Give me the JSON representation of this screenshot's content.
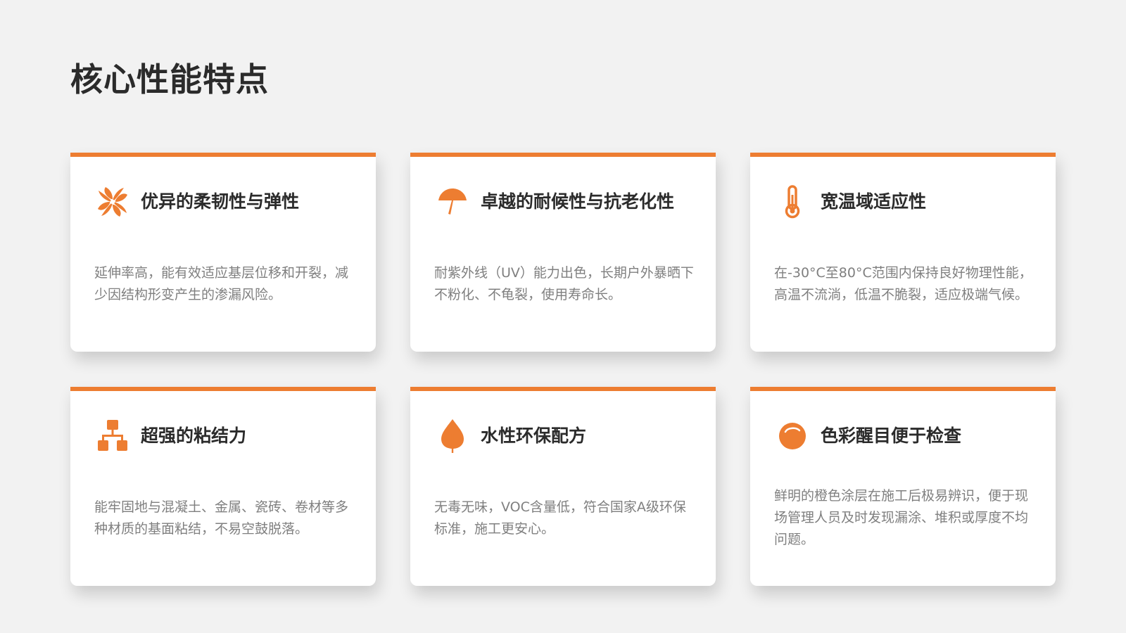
{
  "page": {
    "title": "核心性能特点"
  },
  "theme": {
    "accent": "#ed7d31",
    "title_color": "#2b2b2b",
    "text_color": "#7f7f7f",
    "background": "#f2f2f2"
  },
  "cards": [
    {
      "icon": "pinwheel-icon",
      "title": "优异的柔韧性与弹性",
      "description": "延伸率高，能有效适应基层位移和开裂，减少因结构形变产生的渗漏风险。"
    },
    {
      "icon": "umbrella-icon",
      "title": "卓越的耐候性与抗老化性",
      "description": "耐紫外线（UV）能力出色，长期户外暴晒下不粉化、不龟裂，使用寿命长。"
    },
    {
      "icon": "thermometer-icon",
      "title": "宽温域适应性",
      "description": "在-30°C至80°C范围内保持良好物理性能，高温不流淌，低温不脆裂，适应极端气候。"
    },
    {
      "icon": "network-hierarchy-icon",
      "title": "超强的粘结力",
      "description": "能牢固地与混凝土、金属、瓷砖、卷材等多种材质的基面粘结，不易空鼓脱落。"
    },
    {
      "icon": "leaf-icon",
      "title": "水性环保配方",
      "description": "无毒无味，VOC含量低，符合国家A级环保标准，施工更安心。"
    },
    {
      "icon": "color-circle-icon",
      "title": "色彩醒目便于检查",
      "description": "鲜明的橙色涂层在施工后极易辨识，便于现场管理人员及时发现漏涂、堆积或厚度不均问题。"
    }
  ]
}
